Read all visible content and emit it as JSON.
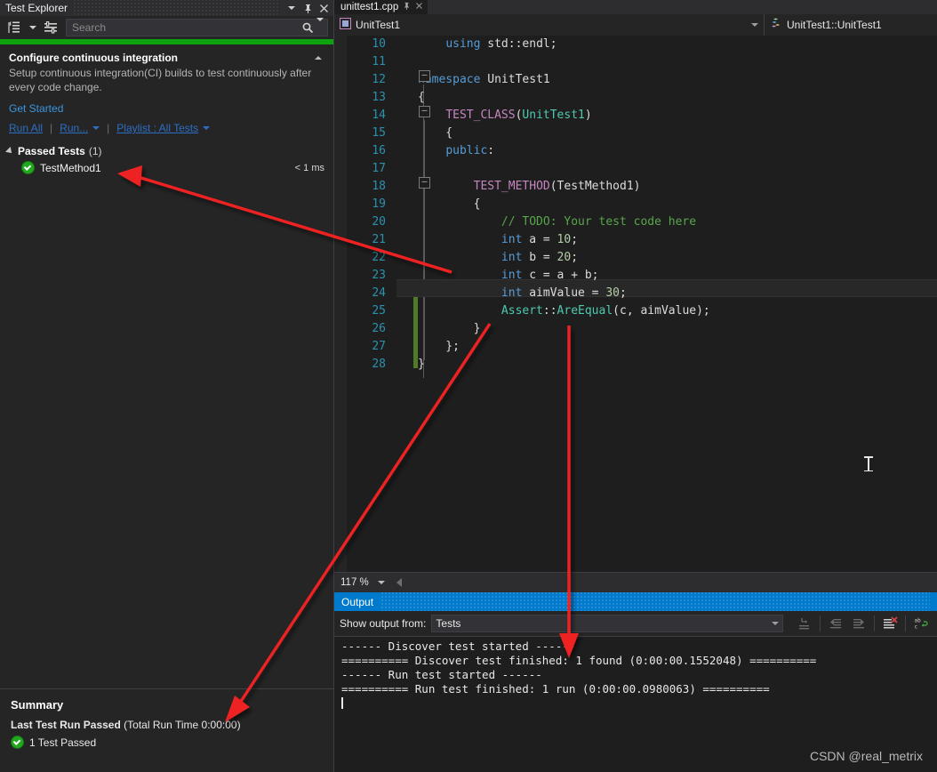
{
  "test_explorer": {
    "title": "Test Explorer",
    "window_buttons": [
      "chevron-down",
      "pin",
      "close"
    ],
    "toolbar": {
      "group_by_icon": "group-by-icon",
      "group_by_caret": "chevron-down-icon",
      "settings_icon": "test-settings-icon",
      "search_placeholder": "Search",
      "search_value": "",
      "search_icon": "search-icon",
      "search_caret": "chevron-down-icon"
    },
    "ci_panel": {
      "title": "Configure continuous integration",
      "description": "Setup continuous integration(CI) builds to test continuously after every code change.",
      "link": "Get Started",
      "collapse_icon": "chevron-up-icon"
    },
    "run_bar": {
      "run_all": "Run All",
      "run": "Run...",
      "playlist": "Playlist : All Tests",
      "separator": "|"
    },
    "tree": {
      "group_label": "Passed Tests",
      "group_count": "(1)",
      "rows": [
        {
          "name": "TestMethod1",
          "duration": "< 1 ms",
          "status_icon": "passed-check-icon"
        }
      ]
    },
    "summary": {
      "title": "Summary",
      "result_bold": "Last Test Run Passed",
      "result_rest": " (Total Run Time 0:00:00)",
      "passed_line": "1 Test Passed",
      "passed_icon": "passed-check-icon"
    }
  },
  "editor": {
    "tab": {
      "filename": "unittest1.cpp",
      "pin_icon": "pin-icon",
      "close_icon": "close-icon"
    },
    "navbar": {
      "left_value": "UnitTest1",
      "left_icon": "project-icon",
      "right_value": "UnitTest1::UnitTest1",
      "right_icon": "class-members-icon"
    },
    "zoom_level": "117 %",
    "lines": [
      {
        "n": "10",
        "tokens": [
          {
            "t": "    ",
            "c": "pl"
          },
          {
            "t": "using",
            "c": "k"
          },
          {
            "t": " std::endl;",
            "c": "pl"
          }
        ]
      },
      {
        "n": "11",
        "tokens": []
      },
      {
        "n": "12",
        "tokens": [
          {
            "t": "namespace",
            "c": "k"
          },
          {
            "t": " UnitTest1",
            "c": "pl"
          }
        ]
      },
      {
        "n": "13",
        "tokens": [
          {
            "t": "{",
            "c": "pl"
          }
        ]
      },
      {
        "n": "14",
        "tokens": [
          {
            "t": "    ",
            "c": "pl"
          },
          {
            "t": "TEST_CLASS",
            "c": "mac"
          },
          {
            "t": "(",
            "c": "pl"
          },
          {
            "t": "UnitTest1",
            "c": "typ"
          },
          {
            "t": ")",
            "c": "pl"
          }
        ]
      },
      {
        "n": "15",
        "tokens": [
          {
            "t": "    {",
            "c": "pl"
          }
        ]
      },
      {
        "n": "16",
        "tokens": [
          {
            "t": "    ",
            "c": "pl"
          },
          {
            "t": "public",
            "c": "k"
          },
          {
            "t": ":",
            "c": "pl"
          }
        ]
      },
      {
        "n": "17",
        "tokens": []
      },
      {
        "n": "18",
        "tokens": [
          {
            "t": "        ",
            "c": "pl"
          },
          {
            "t": "TEST_METHOD",
            "c": "mac"
          },
          {
            "t": "(",
            "c": "pl"
          },
          {
            "t": "TestMethod1",
            "c": "pl"
          },
          {
            "t": ")",
            "c": "pl"
          }
        ]
      },
      {
        "n": "19",
        "tokens": [
          {
            "t": "        {",
            "c": "pl"
          }
        ]
      },
      {
        "n": "20",
        "tokens": [
          {
            "t": "            ",
            "c": "pl"
          },
          {
            "t": "// TODO: Your test code here",
            "c": "cmt"
          }
        ]
      },
      {
        "n": "21",
        "tokens": [
          {
            "t": "            ",
            "c": "pl"
          },
          {
            "t": "int",
            "c": "k"
          },
          {
            "t": " a = ",
            "c": "pl"
          },
          {
            "t": "10",
            "c": "num"
          },
          {
            "t": ";",
            "c": "pl"
          }
        ]
      },
      {
        "n": "22",
        "tokens": [
          {
            "t": "            ",
            "c": "pl"
          },
          {
            "t": "int",
            "c": "k"
          },
          {
            "t": " b = ",
            "c": "pl"
          },
          {
            "t": "20",
            "c": "num"
          },
          {
            "t": ";",
            "c": "pl"
          }
        ]
      },
      {
        "n": "23",
        "tokens": [
          {
            "t": "            ",
            "c": "pl"
          },
          {
            "t": "int",
            "c": "k"
          },
          {
            "t": " c = a + b;",
            "c": "pl"
          }
        ]
      },
      {
        "n": "24",
        "tokens": [
          {
            "t": "            ",
            "c": "pl"
          },
          {
            "t": "int",
            "c": "k"
          },
          {
            "t": " aimValue = ",
            "c": "pl"
          },
          {
            "t": "30",
            "c": "num"
          },
          {
            "t": ";",
            "c": "pl"
          }
        ]
      },
      {
        "n": "25",
        "tokens": [
          {
            "t": "            ",
            "c": "pl"
          },
          {
            "t": "Assert",
            "c": "typ"
          },
          {
            "t": "::",
            "c": "pl"
          },
          {
            "t": "AreEqual",
            "c": "typ"
          },
          {
            "t": "(c, aimValue);",
            "c": "pl"
          }
        ]
      },
      {
        "n": "26",
        "tokens": [
          {
            "t": "        }",
            "c": "pl"
          }
        ]
      },
      {
        "n": "27",
        "tokens": [
          {
            "t": "    };",
            "c": "pl"
          }
        ]
      },
      {
        "n": "28",
        "tokens": [
          {
            "t": "}",
            "c": "pl"
          }
        ]
      }
    ],
    "highlighted_line": "24"
  },
  "output": {
    "title": "Output",
    "show_output_from_label": "Show output from:",
    "show_output_from_value": "Tests",
    "tool_icons": [
      "find-message-icon",
      "go-to-previous-message-icon",
      "go-to-next-message-icon",
      "clear-all-icon",
      "toggle-word-wrap-icon"
    ],
    "lines": [
      "------ Discover test started ------",
      "========== Discover test finished: 1 found (0:00:00.1552048) ==========",
      "------ Run test started ------",
      "========== Run test finished: 1 run (0:00:00.0980063) =========="
    ]
  },
  "watermark": "CSDN @real_metrix",
  "colors": {
    "accent_blue": "#007acc",
    "pass_green": "#22a81f",
    "progress_green": "#0ea30e",
    "annotation_red": "#ee2222",
    "link_blue": "#2c6fc4",
    "ci_link_blue": "#3b96dd"
  }
}
